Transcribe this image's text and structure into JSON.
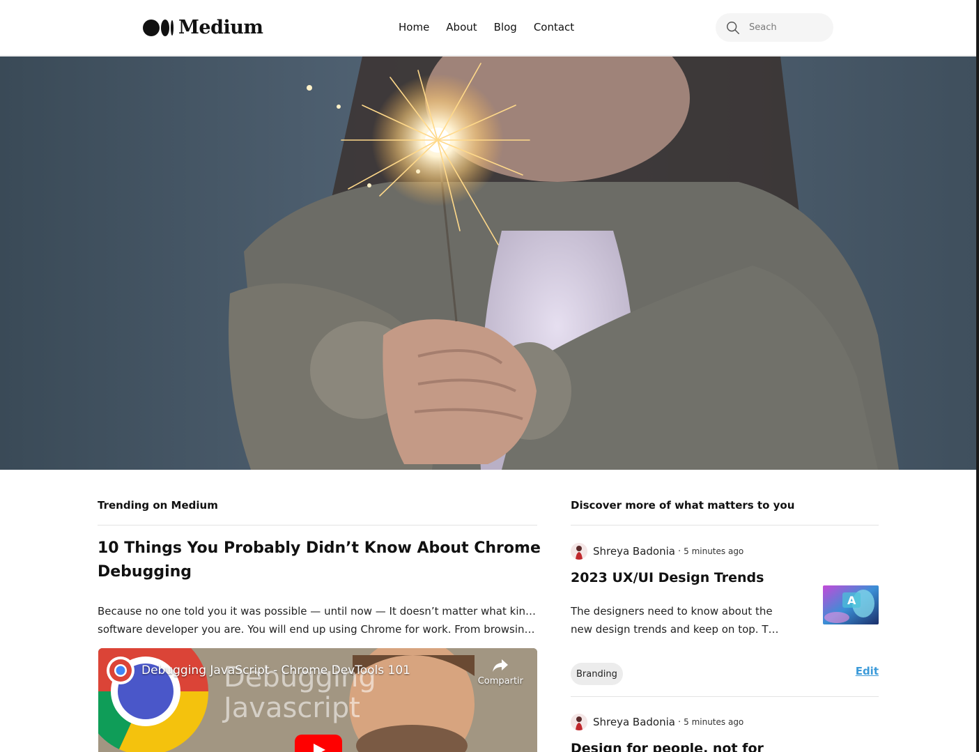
{
  "brand": {
    "name": "Medium"
  },
  "nav": {
    "items": [
      {
        "label": "Home"
      },
      {
        "label": "About"
      },
      {
        "label": "Blog"
      },
      {
        "label": "Contact"
      }
    ]
  },
  "search": {
    "placeholder": "Seach",
    "icon": "search-icon"
  },
  "hero": {
    "alt": "Person holding a lit sparkler"
  },
  "trending": {
    "heading": "Trending on Medium",
    "article": {
      "title": "10 Things You Probably Didn’t Know About Chrome Debugging",
      "excerpt_line1": "Because no one told you it was possible — until now — It doesn’t matter what kind of",
      "excerpt_line2": "software developer you are. You will end up using Chrome for work. From browsing ca…"
    },
    "video": {
      "title": "Debugging JavaScript - Chrome DevTools 101",
      "share_label": "Compartir",
      "background_text_1": "Debugging",
      "background_text_2": "Javascript"
    }
  },
  "discover": {
    "heading": "Discover more of what matters to you",
    "cards": [
      {
        "author": "Shreya Badonia",
        "separator": "·",
        "time": "5 minutes ago",
        "title": "2023 UX/UI Design Trends",
        "excerpt_line1": "The designers need to know about the",
        "excerpt_line2": "new design trends and keep on top. The…",
        "tag": "Branding",
        "edit_label": "Edit"
      },
      {
        "author": "Shreya Badonia",
        "separator": "·",
        "time": "5 minutes ago",
        "title": "Design for people, not for"
      }
    ]
  },
  "colors": {
    "accent_link": "#3b9ad9",
    "text": "#111111",
    "tag_bg": "#ececec",
    "search_bg": "#f5f5f5"
  }
}
